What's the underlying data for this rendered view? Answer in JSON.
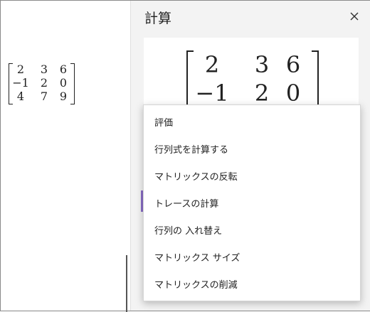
{
  "pane": {
    "title": "計算",
    "close_label": "×"
  },
  "matrix": {
    "rows": [
      [
        "2",
        "3",
        "6"
      ],
      [
        "−1",
        "2",
        "0"
      ],
      [
        "4",
        "7",
        "9"
      ]
    ]
  },
  "menu": {
    "items": [
      "評価",
      "行列式を計算する",
      "マトリックスの反転",
      "トレースの計算",
      "行列の 入れ替え",
      "マトリックス サイズ",
      "マトリックスの削減"
    ]
  },
  "colors": {
    "pane_background": "#f3f3f3",
    "accent": "#8a6dc7"
  }
}
